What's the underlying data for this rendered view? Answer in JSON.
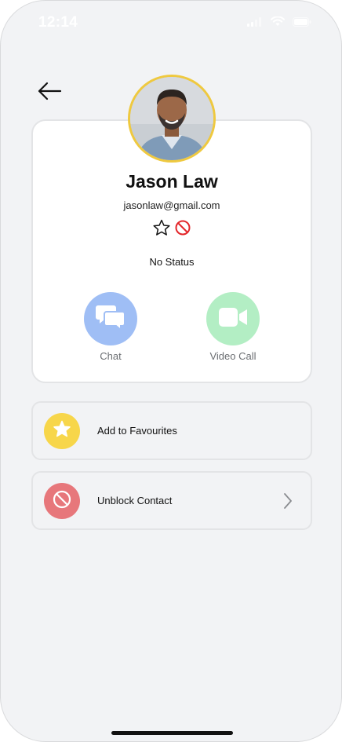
{
  "status_bar": {
    "time": "12:14"
  },
  "contact": {
    "name": "Jason Law",
    "email": "jasonlaw@gmail.com",
    "status": "No Status",
    "avatar_icon": "profile-photo"
  },
  "actions": {
    "chat": {
      "label": "Chat",
      "icon": "chat-bubbles-icon"
    },
    "video": {
      "label": "Video Call",
      "icon": "video-camera-icon"
    }
  },
  "options": {
    "favourites": {
      "label": "Add to Favourites",
      "icon": "star-icon"
    },
    "block": {
      "label": "Unblock Contact",
      "icon": "block-icon"
    }
  },
  "colors": {
    "avatar_ring": "#efc93f",
    "chat": "#9fbef5",
    "video": "#b3eec4",
    "favourite": "#f7d64a",
    "block": "#e7777b",
    "blocked_badge": "#e3262a"
  }
}
